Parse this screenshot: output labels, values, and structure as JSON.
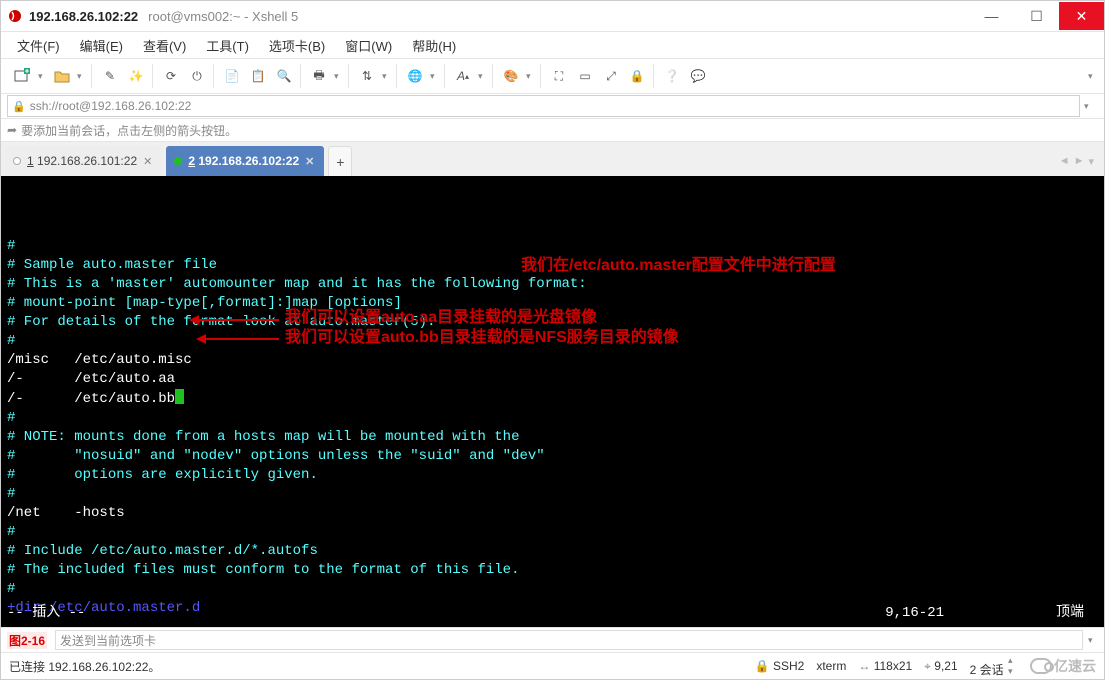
{
  "window": {
    "title_main": "192.168.26.102:22",
    "title_sub": "root@vms002:~ - Xshell 5"
  },
  "menu": {
    "file": "文件(F)",
    "edit": "编辑(E)",
    "view": "查看(V)",
    "tools": "工具(T)",
    "tabs": "选项卡(B)",
    "window": "窗口(W)",
    "help": "帮助(H)"
  },
  "toolbar_icons": [
    "new-tab-icon",
    "open-icon",
    "sep",
    "edit-icon",
    "wand-icon",
    "sep",
    "reconnect-icon",
    "disconnect-icon",
    "sep",
    "copy-icon",
    "paste-icon",
    "find-icon",
    "sep",
    "printer-icon",
    "sep",
    "transfer-icon",
    "sep",
    "globe-icon",
    "sep",
    "font-icon",
    "sep",
    "palette-icon",
    "sep",
    "fullscreen-icon",
    "aspect-icon",
    "expand-icon",
    "lock-icon",
    "sep",
    "help-icon",
    "chat-icon"
  ],
  "address": {
    "url": "ssh://root@192.168.26.102:22"
  },
  "hint": {
    "text": "要添加当前会话，点击左侧的箭头按钮。"
  },
  "tabs": {
    "items": [
      {
        "label": "1 192.168.26.101:22",
        "active": false,
        "indicator": "white"
      },
      {
        "label": "2 192.168.26.102:22",
        "active": true,
        "indicator": "green"
      }
    ],
    "add_tooltip": "+"
  },
  "terminal": {
    "lines": [
      {
        "cls": "c-cy",
        "text": "#"
      },
      {
        "cls": "c-cy",
        "text": "# Sample auto.master file"
      },
      {
        "cls": "c-cy",
        "text": "# This is a 'master' automounter map and it has the following format:"
      },
      {
        "cls": "c-cy",
        "text": "# mount-point [map-type[,format]:]map [options]"
      },
      {
        "cls": "c-cy",
        "text": "# For details of the format look at auto.master(5)."
      },
      {
        "cls": "c-cy",
        "text": "#"
      },
      {
        "cls": "c-wh",
        "text": "/misc   /etc/auto.misc"
      },
      {
        "cls": "c-wh",
        "text": "/-      /etc/auto.aa"
      },
      {
        "cls": "c-wh",
        "text_cursor": "/-      /etc/auto.bb"
      },
      {
        "cls": "c-cy",
        "text": "#"
      },
      {
        "cls": "c-cy",
        "text": "# NOTE: mounts done from a hosts map will be mounted with the"
      },
      {
        "cls": "c-cy",
        "text": "#       \"nosuid\" and \"nodev\" options unless the \"suid\" and \"dev\""
      },
      {
        "cls": "c-cy",
        "text": "#       options are explicitly given."
      },
      {
        "cls": "c-cy",
        "text": "#"
      },
      {
        "cls": "c-wh",
        "text": "/net    -hosts"
      },
      {
        "cls": "c-cy",
        "text": "#"
      },
      {
        "cls": "c-cy",
        "text": "# Include /etc/auto.master.d/*.autofs"
      },
      {
        "cls": "c-cy",
        "text": "# The included files must conform to the format of this file."
      },
      {
        "cls": "c-cy",
        "text": "#"
      },
      {
        "cls": "c-bl",
        "text": "+dir:/etc/auto.master.d"
      }
    ],
    "mode_line": {
      "left": "-- 插入 --",
      "pos": "9,16-21",
      "right": "顶端"
    },
    "annotations": {
      "top_right": "我们在/etc/auto.master配置文件中进行配置",
      "line_aa": "我们可以设置auto.aa目录挂载的是光盘镜像",
      "line_bb": "我们可以设置auto.bb目录挂载的是NFS服务目录的镜像"
    }
  },
  "input_bar": {
    "figure_label": "图2-16",
    "placeholder": "发送到当前选项卡"
  },
  "status": {
    "left": "已连接 192.168.26.102:22。",
    "ssh": "SSH2",
    "term": "xterm",
    "wh": "118x21",
    "pos": "9,21",
    "sessions": "2 会话",
    "brand": "亿速云"
  }
}
